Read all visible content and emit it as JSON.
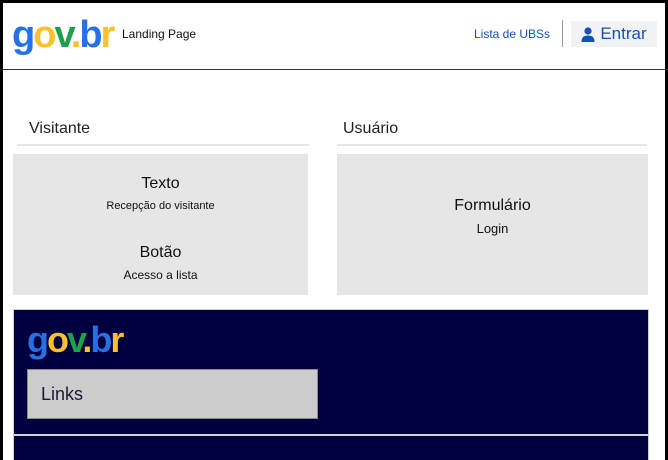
{
  "header": {
    "logo": {
      "g": "g",
      "o": "o",
      "v": "v",
      "dot": ".",
      "b": "b",
      "r": "r"
    },
    "title": "Landing Page",
    "ubs_link": "Lista de UBSs",
    "login_button": "Entrar"
  },
  "visitante": {
    "heading": "Visitante",
    "texto_title": "Texto",
    "texto_sub": "Recepção do visitante",
    "botao_title": "Botão",
    "botao_sub": "Acesso a lista"
  },
  "usuario": {
    "heading": "Usuário",
    "form_title": "Formulário",
    "form_sub": "Login"
  },
  "footer": {
    "logo": {
      "g": "g",
      "o": "o",
      "v": "v",
      "dot": ".",
      "b": "b",
      "r": "r"
    },
    "links_label": "Links"
  },
  "colors": {
    "primary_blue": "#1351b4",
    "footer_navy": "#00003e",
    "card_gray": "#e6e6e6"
  },
  "icons": {
    "login": "user-icon"
  }
}
